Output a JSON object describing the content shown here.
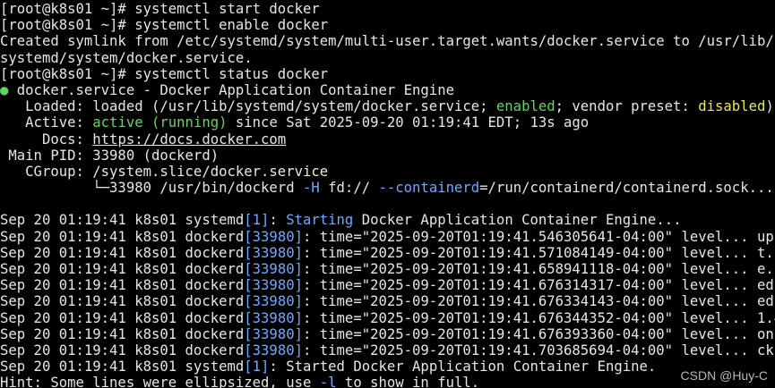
{
  "colors": {
    "background": "#000000",
    "foreground": "#e6e6e6",
    "green": "#5fd75f",
    "yellow": "#e8e84a",
    "blue": "#6fa8ff"
  },
  "lines": {
    "l1": "[root@k8s01 ~]# systemctl start docker",
    "l2": "[root@k8s01 ~]# systemctl enable docker",
    "l3": "Created symlink from /etc/systemd/system/multi-user.target.wants/docker.service to /usr/lib/",
    "l4": "systemd/system/docker.service.",
    "l5": "[root@k8s01 ~]# systemctl status docker",
    "l6_dot": "●",
    "l6_rest": " docker.service - Docker Application Container Engine",
    "l7_a": "   Loaded: loaded (/usr/lib/systemd/system/docker.service; ",
    "l7_enabled": "enabled",
    "l7_b": "; vendor preset: ",
    "l7_disabled": "disabled",
    "l7_c": ")",
    "l8_a": "   Active: ",
    "l8_active": "active (running)",
    "l8_b": " since Sat 2025-09-20 01:19:41 EDT; 13s ago",
    "l9_a": "     Docs: ",
    "l9_link": "https://docs.docker.com",
    "l10": " Main PID: 33980 (dockerd)",
    "l11": "   CGroup: /system.slice/docker.service",
    "l12_a": "           └─33980 /usr/bin/dockerd ",
    "l12_H": "-H",
    "l12_b": " fd:// ",
    "l12_c": "--containerd",
    "l12_d": "=/run/containerd/containerd.sock",
    "l12_e": "...",
    "l13": "",
    "l14_a": "Sep 20 01:19:41 k8s01 systemd",
    "l14_pid": "[1]",
    "l14_b": ": ",
    "l14_starting": "Starting",
    "l14_c": " Docker Application Container Engine",
    "l14_d": "...",
    "logs": [
      {
        "pre": "Sep 20 01:19:41 k8s01 dockerd",
        "pid": "[33980]",
        "msg": ": time=\"2025-09-20T01:19:41.546305641-04:00\" level",
        "tail": "... up\""
      },
      {
        "pre": "Sep 20 01:19:41 k8s01 dockerd",
        "pid": "[33980]",
        "msg": ": time=\"2025-09-20T01:19:41.571084149-04:00\" level",
        "tail": "... t.\""
      },
      {
        "pre": "Sep 20 01:19:41 k8s01 dockerd",
        "pid": "[33980]",
        "msg": ": time=\"2025-09-20T01:19:41.658941118-04:00\" level",
        "tail": "... e.\""
      },
      {
        "pre": "Sep 20 01:19:41 k8s01 dockerd",
        "pid": "[33980]",
        "msg": ": time=\"2025-09-20T01:19:41.676314317-04:00\" level",
        "tail": "... ed\""
      },
      {
        "pre": "Sep 20 01:19:41 k8s01 dockerd",
        "pid": "[33980]",
        "msg": ": time=\"2025-09-20T01:19:41.676334143-04:00\" level",
        "tail": "... ed\""
      },
      {
        "pre": "Sep 20 01:19:41 k8s01 dockerd",
        "pid": "[33980]",
        "msg": ": time=\"2025-09-20T01:19:41.676344352-04:00\" level",
        "tail": "... 1.4"
      },
      {
        "pre": "Sep 20 01:19:41 k8s01 dockerd",
        "pid": "[33980]",
        "msg": ": time=\"2025-09-20T01:19:41.676393360-04:00\" level",
        "tail": "... on\""
      },
      {
        "pre": "Sep 20 01:19:41 k8s01 dockerd",
        "pid": "[33980]",
        "msg": ": time=\"2025-09-20T01:19:41.703685694-04:00\" level",
        "tail": "... ck\""
      }
    ],
    "l23_a": "Sep 20 01:19:41 k8s01 systemd",
    "l23_pid": "[1]",
    "l23_b": ": Started Docker Application Container Engine.",
    "l24_a": "Hint: Some lines were ellipsized, use ",
    "l24_flag": "-l",
    "l24_b": " to show in full."
  },
  "watermark": "CSDN @Huy-C"
}
